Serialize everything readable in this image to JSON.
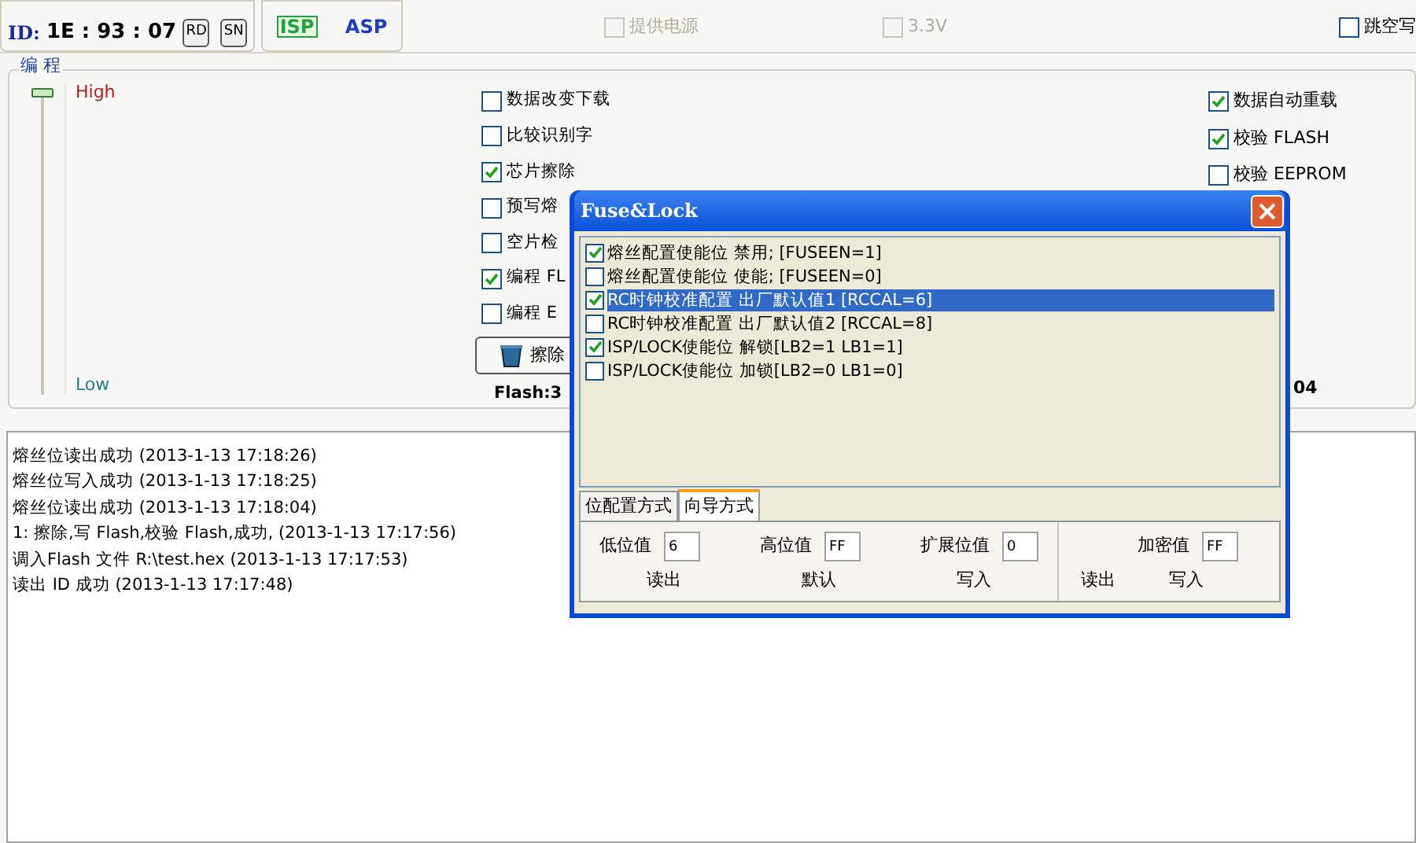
{
  "top": {
    "id_label": "ID:",
    "id_value": "1E : 93 : 07",
    "buttons": [
      "RD",
      "SN"
    ],
    "logos": [
      "ISP",
      "ASP"
    ],
    "options": [
      {
        "label": "提供电源",
        "checked": false,
        "disabled": true
      },
      {
        "label": "3.3V",
        "checked": false,
        "disabled": true
      },
      {
        "label": "跳空写",
        "checked": false,
        "disabled": false
      }
    ]
  },
  "program": {
    "title": "编 程",
    "slider": {
      "high": "High",
      "low": "Low",
      "level": 1
    },
    "options": [
      {
        "label": "数据改变下载",
        "checked": false
      },
      {
        "label": "比较识别字",
        "checked": false
      },
      {
        "label": "芯片擦除",
        "checked": true
      },
      {
        "label": "预写熔",
        "checked": false
      },
      {
        "label": "空片检",
        "checked": false
      },
      {
        "label": "编程 FL",
        "checked": true
      },
      {
        "label": "编程 E",
        "checked": false
      }
    ],
    "right_options": [
      {
        "label": "数据自动重载",
        "checked": true
      },
      {
        "label": "校验 FLASH",
        "checked": true
      },
      {
        "label": "校验 EEPROM",
        "checked": false
      }
    ],
    "erase_button": "擦除",
    "flash_size": "Flash:3",
    "size_tail": "04"
  },
  "log": [
    "熔丝位读出成功 (2013-1-13 17:18:26)",
    "熔丝位写入成功 (2013-1-13 17:18:25)",
    "熔丝位读出成功 (2013-1-13 17:18:04)",
    "1: 擦除,写 Flash,校验 Flash,成功, (2013-1-13 17:17:56)",
    "调入Flash 文件 R:\\test.hex (2013-1-13 17:17:53)",
    "读出 ID 成功 (2013-1-13 17:17:48)"
  ],
  "dialog": {
    "title": "Fuse&Lock",
    "items": [
      {
        "label": "熔丝配置使能位 禁用; [FUSEEN=1]",
        "checked": true,
        "selected": false
      },
      {
        "label": "熔丝配置使能位 使能; [FUSEEN=0]",
        "checked": false,
        "selected": false
      },
      {
        "label": "RC时钟校准配置 出厂默认值1 [RCCAL=6]",
        "checked": true,
        "selected": true
      },
      {
        "label": "RC时钟校准配置 出厂默认值2 [RCCAL=8]",
        "checked": false,
        "selected": false
      },
      {
        "label": "ISP/LOCK使能位 解锁[LB2=1 LB1=1]",
        "checked": true,
        "selected": false
      },
      {
        "label": "ISP/LOCK使能位 加锁[LB2=0 LB1=0]",
        "checked": false,
        "selected": false
      }
    ],
    "tabs": [
      {
        "label": "位配置方式",
        "selected": false
      },
      {
        "label": "向导方式",
        "selected": true
      }
    ],
    "fields": [
      {
        "label": "低位值",
        "value": "6"
      },
      {
        "label": "高位值",
        "value": "FF"
      },
      {
        "label": "扩展位值",
        "value": "0"
      }
    ],
    "actions": [
      "读出",
      "默认",
      "写入"
    ],
    "lock_field": {
      "label": "加密值",
      "value": "FF"
    },
    "lock_actions": [
      "读出",
      "写入"
    ]
  }
}
